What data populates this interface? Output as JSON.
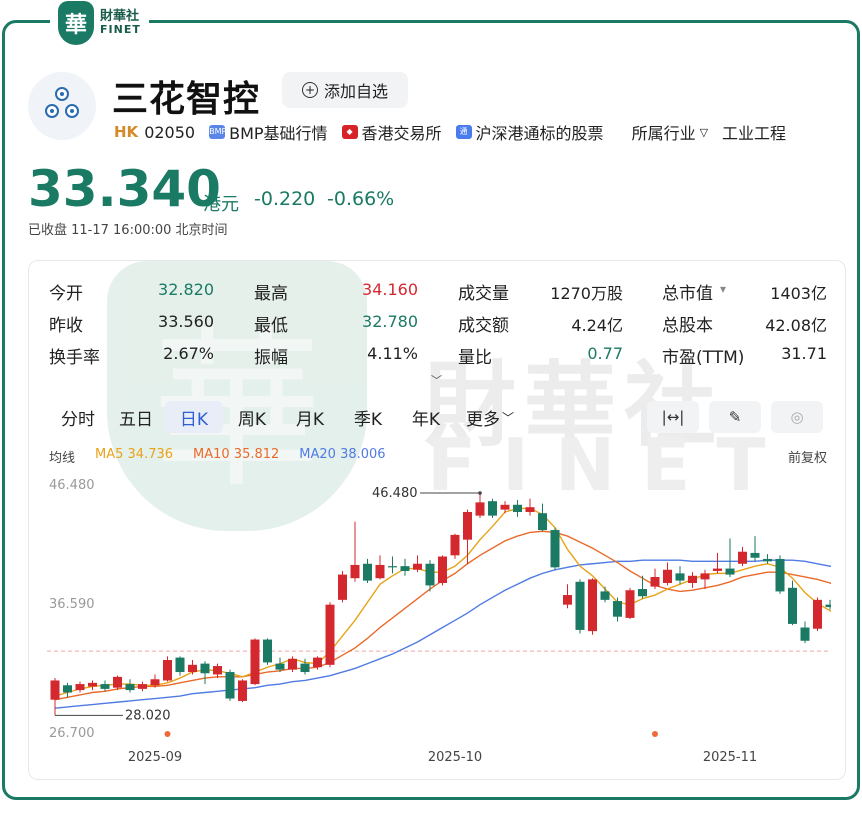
{
  "brand": {
    "badge": "華",
    "cn": "財華社",
    "en": "FINET"
  },
  "stock": {
    "name": "三花智控",
    "add_label": "添加自选",
    "market": "HK",
    "code": "02050",
    "tags": [
      "BMP基础行情",
      "香港交易所",
      "沪深港通标的股票"
    ],
    "industry_label": "所属行业",
    "industry_value": "工业工程"
  },
  "quote": {
    "price": "33.340",
    "currency": "港元",
    "change": "-0.220",
    "change_pct": "-0.66%",
    "status": "已收盘 11-17 16:00:00 北京时间",
    "color": "#1a7a63"
  },
  "stats": [
    {
      "label": "今开",
      "value": "32.820",
      "color": "#1a7a63"
    },
    {
      "label": "最高",
      "value": "34.160",
      "color": "#d4282f"
    },
    {
      "label": "成交量",
      "value": "1270万股",
      "color": "#222222"
    },
    {
      "label": "总市值",
      "value": "1403亿",
      "color": "#222222"
    },
    {
      "label": "昨收",
      "value": "33.560",
      "color": "#222222"
    },
    {
      "label": "最低",
      "value": "32.780",
      "color": "#1a7a63"
    },
    {
      "label": "成交额",
      "value": "4.24亿",
      "color": "#222222"
    },
    {
      "label": "总股本",
      "value": "42.08亿",
      "color": "#222222"
    },
    {
      "label": "换手率",
      "value": "2.67%",
      "color": "#222222"
    },
    {
      "label": "振幅",
      "value": "4.11%",
      "color": "#222222"
    },
    {
      "label": "量比",
      "value": "0.77",
      "color": "#1a7a63"
    },
    {
      "label": "市盈(TTM)",
      "value": "31.71",
      "color": "#222222"
    }
  ],
  "tabs": [
    "分时",
    "五日",
    "日K",
    "周K",
    "月K",
    "季K",
    "年K",
    "更多"
  ],
  "active_tab": "日K",
  "tools": [
    "expand-horizontal-icon",
    "draw-tool-icon",
    "settings-dial-icon"
  ],
  "indicators": {
    "label": "均线",
    "ma5": "MA5 34.736",
    "ma10": "MA10 35.812",
    "ma20": "MA20 38.006",
    "adjust": "前复权",
    "colors": {
      "ma5": "#e8a317",
      "ma10": "#ea6a2a",
      "ma20": "#4f7be3",
      "up": "#d4282f",
      "down": "#1a7a63"
    }
  },
  "chart_data": {
    "type": "candlestick",
    "y_ticks": [
      "46.480",
      "36.590",
      "26.700"
    ],
    "ylim": [
      26.7,
      46.48
    ],
    "x_ticks": [
      "2025-09",
      "2025-10",
      "2025-11"
    ],
    "x_tick_index": [
      8,
      32,
      54
    ],
    "max_marker": "46.480",
    "max_index": 34,
    "min_marker": "28.020",
    "min_index": 0,
    "last_close": 33.34,
    "candles": [
      {
        "o": 29.3,
        "c": 30.9,
        "h": 31.1,
        "l": 28.0
      },
      {
        "o": 30.5,
        "c": 29.9,
        "h": 30.7,
        "l": 29.5
      },
      {
        "o": 30.1,
        "c": 30.6,
        "h": 30.8,
        "l": 29.9
      },
      {
        "o": 30.4,
        "c": 30.7,
        "h": 30.9,
        "l": 30.1
      },
      {
        "o": 30.6,
        "c": 30.2,
        "h": 30.9,
        "l": 30.0
      },
      {
        "o": 30.3,
        "c": 31.2,
        "h": 31.3,
        "l": 30.1
      },
      {
        "o": 30.6,
        "c": 30.1,
        "h": 31.0,
        "l": 29.9
      },
      {
        "o": 30.2,
        "c": 30.6,
        "h": 30.8,
        "l": 30.0
      },
      {
        "o": 30.5,
        "c": 31.0,
        "h": 31.4,
        "l": 30.3
      },
      {
        "o": 30.9,
        "c": 32.6,
        "h": 32.9,
        "l": 30.8
      },
      {
        "o": 32.8,
        "c": 31.6,
        "h": 32.9,
        "l": 31.3
      },
      {
        "o": 31.6,
        "c": 32.2,
        "h": 32.6,
        "l": 31.4
      },
      {
        "o": 32.3,
        "c": 31.5,
        "h": 32.5,
        "l": 30.6
      },
      {
        "o": 31.4,
        "c": 32.1,
        "h": 32.3,
        "l": 31.1
      },
      {
        "o": 31.6,
        "c": 29.4,
        "h": 31.8,
        "l": 29.2
      },
      {
        "o": 29.2,
        "c": 30.9,
        "h": 31.0,
        "l": 29.1
      },
      {
        "o": 30.6,
        "c": 34.3,
        "h": 34.4,
        "l": 30.5
      },
      {
        "o": 34.3,
        "c": 32.4,
        "h": 34.4,
        "l": 32.2
      },
      {
        "o": 32.3,
        "c": 31.8,
        "h": 32.8,
        "l": 31.6
      },
      {
        "o": 31.8,
        "c": 32.7,
        "h": 32.9,
        "l": 31.6
      },
      {
        "o": 32.3,
        "c": 31.6,
        "h": 32.7,
        "l": 31.4
      },
      {
        "o": 32.0,
        "c": 32.8,
        "h": 32.9,
        "l": 31.8
      },
      {
        "o": 32.2,
        "c": 37.2,
        "h": 37.4,
        "l": 32.0
      },
      {
        "o": 37.6,
        "c": 39.7,
        "h": 40.0,
        "l": 37.4
      },
      {
        "o": 39.4,
        "c": 40.5,
        "h": 44.1,
        "l": 39.1
      },
      {
        "o": 40.6,
        "c": 39.2,
        "h": 41.0,
        "l": 39.0
      },
      {
        "o": 39.4,
        "c": 40.5,
        "h": 41.3,
        "l": 39.3
      },
      {
        "o": 40.4,
        "c": 40.3,
        "h": 41.2,
        "l": 39.8
      },
      {
        "o": 40.4,
        "c": 40.0,
        "h": 41.0,
        "l": 39.6
      },
      {
        "o": 40.1,
        "c": 40.6,
        "h": 41.3,
        "l": 39.9
      },
      {
        "o": 40.6,
        "c": 38.8,
        "h": 40.9,
        "l": 38.3
      },
      {
        "o": 39.0,
        "c": 41.2,
        "h": 41.3,
        "l": 38.8
      },
      {
        "o": 41.3,
        "c": 43.0,
        "h": 43.1,
        "l": 41.0
      },
      {
        "o": 42.6,
        "c": 44.9,
        "h": 45.1,
        "l": 40.6
      },
      {
        "o": 44.6,
        "c": 45.7,
        "h": 46.48,
        "l": 44.4
      },
      {
        "o": 45.8,
        "c": 44.6,
        "h": 46.0,
        "l": 44.4
      },
      {
        "o": 45.1,
        "c": 45.5,
        "h": 45.8,
        "l": 44.8
      },
      {
        "o": 45.5,
        "c": 44.9,
        "h": 45.9,
        "l": 44.5
      },
      {
        "o": 44.9,
        "c": 45.3,
        "h": 46.0,
        "l": 44.6
      },
      {
        "o": 44.8,
        "c": 43.4,
        "h": 45.6,
        "l": 43.3
      },
      {
        "o": 43.4,
        "c": 40.3,
        "h": 43.6,
        "l": 40.1
      },
      {
        "o": 37.2,
        "c": 38.0,
        "h": 38.9,
        "l": 36.9
      },
      {
        "o": 39.1,
        "c": 35.1,
        "h": 39.3,
        "l": 34.8
      },
      {
        "o": 35.0,
        "c": 39.3,
        "h": 39.4,
        "l": 34.7
      },
      {
        "o": 38.3,
        "c": 37.6,
        "h": 38.7,
        "l": 37.4
      },
      {
        "o": 37.5,
        "c": 36.2,
        "h": 37.8,
        "l": 35.8
      },
      {
        "o": 36.1,
        "c": 38.4,
        "h": 38.6,
        "l": 36.0
      },
      {
        "o": 38.5,
        "c": 37.9,
        "h": 39.6,
        "l": 37.7
      },
      {
        "o": 38.7,
        "c": 39.5,
        "h": 40.2,
        "l": 38.5
      },
      {
        "o": 39.0,
        "c": 40.1,
        "h": 40.7,
        "l": 38.8
      },
      {
        "o": 39.8,
        "c": 39.2,
        "h": 40.4,
        "l": 38.9
      },
      {
        "o": 39.0,
        "c": 39.6,
        "h": 39.9,
        "l": 38.6
      },
      {
        "o": 39.3,
        "c": 39.8,
        "h": 40.1,
        "l": 38.5
      },
      {
        "o": 40.0,
        "c": 40.2,
        "h": 41.5,
        "l": 39.8
      },
      {
        "o": 40.2,
        "c": 39.7,
        "h": 42.7,
        "l": 39.5
      },
      {
        "o": 40.6,
        "c": 41.6,
        "h": 42.0,
        "l": 40.4
      },
      {
        "o": 41.5,
        "c": 41.1,
        "h": 42.9,
        "l": 40.8
      },
      {
        "o": 41.0,
        "c": 40.8,
        "h": 41.4,
        "l": 40.6
      },
      {
        "o": 41.0,
        "c": 38.3,
        "h": 41.3,
        "l": 38.1
      },
      {
        "o": 38.6,
        "c": 35.6,
        "h": 39.2,
        "l": 35.5
      },
      {
        "o": 35.3,
        "c": 34.2,
        "h": 35.8,
        "l": 34.0
      },
      {
        "o": 35.2,
        "c": 37.6,
        "h": 37.8,
        "l": 35.0
      },
      {
        "o": 37.2,
        "c": 37.0,
        "h": 37.6,
        "l": 36.8
      },
      {
        "o": 36.7,
        "c": 35.4,
        "h": 37.3,
        "l": 35.2
      },
      {
        "o": 35.6,
        "c": 35.1,
        "h": 36.5,
        "l": 34.8
      },
      {
        "o": 34.9,
        "c": 34.5,
        "h": 35.4,
        "l": 34.2
      },
      {
        "o": 34.8,
        "c": 34.7,
        "h": 35.1,
        "l": 33.9
      },
      {
        "o": 34.7,
        "c": 33.3,
        "h": 34.9,
        "l": 33.1
      },
      {
        "o": 32.8,
        "c": 33.34,
        "h": 34.16,
        "l": 32.78
      }
    ],
    "ma5": [
      29.6,
      29.9,
      30.2,
      30.4,
      30.5,
      30.6,
      30.6,
      30.5,
      30.5,
      30.7,
      31.1,
      31.6,
      31.8,
      31.7,
      31.5,
      31.2,
      31.6,
      32.0,
      32.3,
      32.7,
      32.4,
      32.3,
      33.3,
      34.6,
      35.9,
      37.4,
      38.9,
      39.6,
      40.2,
      40.2,
      39.9,
      39.9,
      40.4,
      41.3,
      42.6,
      43.7,
      44.9,
      45.2,
      45.2,
      44.7,
      43.6,
      41.8,
      40.4,
      39.6,
      38.5,
      37.4,
      37.2,
      37.7,
      38.0,
      38.5,
      38.9,
      39.3,
      39.7,
      39.8,
      39.8,
      40.1,
      40.4,
      40.6,
      40.3,
      39.4,
      38.2,
      37.3,
      36.7,
      36.0,
      35.8,
      35.3,
      34.9,
      34.3,
      34.0
    ],
    "ma10": [
      29.3,
      29.5,
      29.7,
      29.9,
      30.0,
      30.2,
      30.3,
      30.4,
      30.4,
      30.5,
      30.7,
      30.9,
      31.1,
      31.2,
      31.2,
      31.2,
      31.4,
      31.6,
      31.7,
      31.9,
      31.9,
      32.0,
      32.4,
      33.0,
      33.6,
      34.4,
      35.3,
      36.1,
      36.9,
      37.7,
      38.5,
      39.2,
      39.8,
      40.6,
      41.3,
      41.9,
      42.5,
      42.9,
      43.2,
      43.3,
      43.2,
      42.9,
      42.4,
      41.9,
      41.3,
      40.7,
      40.0,
      39.4,
      38.8,
      38.5,
      38.3,
      38.4,
      38.6,
      38.8,
      39.1,
      39.5,
      39.7,
      39.9,
      39.9,
      39.7,
      39.5,
      39.3,
      39.0,
      38.5,
      38.0,
      37.4,
      36.8,
      36.2,
      35.6
    ],
    "ma20": [
      28.6,
      28.7,
      28.8,
      28.9,
      29.0,
      29.1,
      29.2,
      29.3,
      29.4,
      29.5,
      29.6,
      29.8,
      29.9,
      30.0,
      30.1,
      30.2,
      30.3,
      30.5,
      30.6,
      30.8,
      30.9,
      31.1,
      31.3,
      31.6,
      31.9,
      32.3,
      32.7,
      33.1,
      33.6,
      34.1,
      34.7,
      35.3,
      35.9,
      36.5,
      37.2,
      37.8,
      38.4,
      38.9,
      39.4,
      39.8,
      40.1,
      40.3,
      40.5,
      40.6,
      40.7,
      40.8,
      40.8,
      40.9,
      40.9,
      40.9,
      40.9,
      40.8,
      40.8,
      40.8,
      40.8,
      40.8,
      40.8,
      40.9,
      40.9,
      40.9,
      40.8,
      40.6,
      40.4,
      40.2,
      39.9,
      39.6,
      39.3,
      39.0,
      38.8
    ]
  }
}
